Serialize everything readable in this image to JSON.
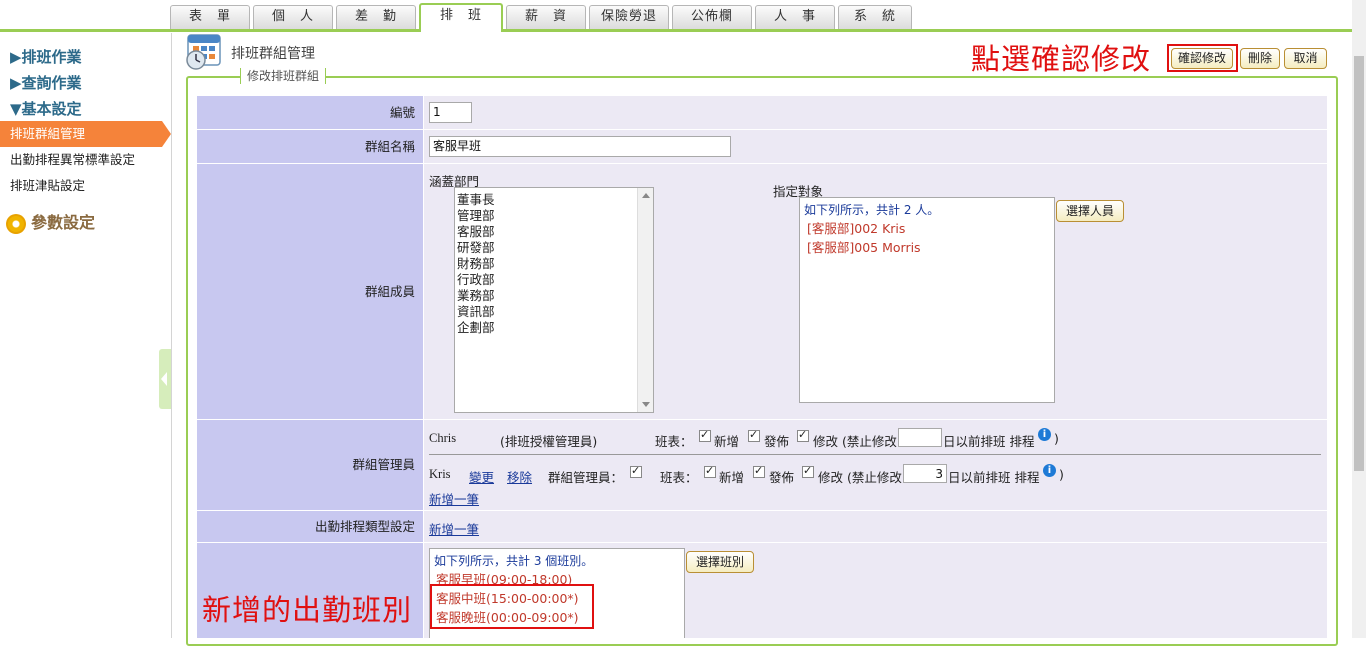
{
  "tabs": [
    "表　單",
    "個　人",
    "差　勤",
    "排　班",
    "薪　資",
    "保險勞退",
    "公佈欄",
    "人　事",
    "系　統"
  ],
  "sidebar": {
    "sections": [
      "▶排班作業",
      "▶查詢作業",
      "▼基本設定"
    ],
    "items": [
      "排班群組管理",
      "出勤排程異常標準設定",
      "排班津貼設定"
    ],
    "param_label": "參數設定"
  },
  "header": {
    "title": "排班群組管理",
    "callout": "點選確認修改",
    "confirm_label": "確認修改",
    "delete_label": "刪除",
    "cancel_label": "取消"
  },
  "form": {
    "legend": "修改排班群組",
    "id_label": "編號",
    "id_value": "1",
    "name_label": "群組名稱",
    "name_value": "客服早班",
    "members_label": "群組成員",
    "dept_caption": "涵蓋部門",
    "departments": [
      "董事長",
      "管理部",
      "客服部",
      "研發部",
      "財務部",
      "行政部",
      "業務部",
      "資訊部",
      "企劃部"
    ],
    "target_caption": "指定對象",
    "target_summary": "如下列所示，共計 2 人。",
    "targets": [
      "[客服部]002 Kris",
      "[客服部]005 Morris"
    ],
    "select_people": "選擇人員",
    "managers_label": "群組管理員",
    "manager1": {
      "name": "Chris",
      "role": "(排班授權管理員)",
      "schedule": "班表：",
      "add": "新增",
      "publish": "發佈",
      "edit": "修改 (禁止修改",
      "days": "",
      "suffix": "日以前排班 排程",
      "close": ")"
    },
    "manager2": {
      "name": "Kris",
      "change": "變更",
      "remove": "移除",
      "group_admin": "群組管理員：",
      "schedule": "班表：",
      "add": "新增",
      "publish": "發佈",
      "edit": "修改 (禁止修改",
      "days": "3",
      "suffix": "日以前排班 排程",
      "close": ")"
    },
    "add_new": "新增一筆",
    "type_label": "出勤排程類型設定",
    "type_add": "新增一筆",
    "shift_summary": "如下列所示，共計 3 個班別。",
    "shifts": [
      "客服早班(09:00-18:00)",
      "客服中班(15:00-00:00*)",
      "客服晚班(00:00-09:00*)"
    ],
    "select_shift": "選擇班別",
    "callout": "新增的出勤班別"
  },
  "colors": {
    "accent_green": "#9acd54",
    "active_orange": "#f5833a",
    "label_bg": "#c8c8f0",
    "callout_red": "#e01010"
  }
}
